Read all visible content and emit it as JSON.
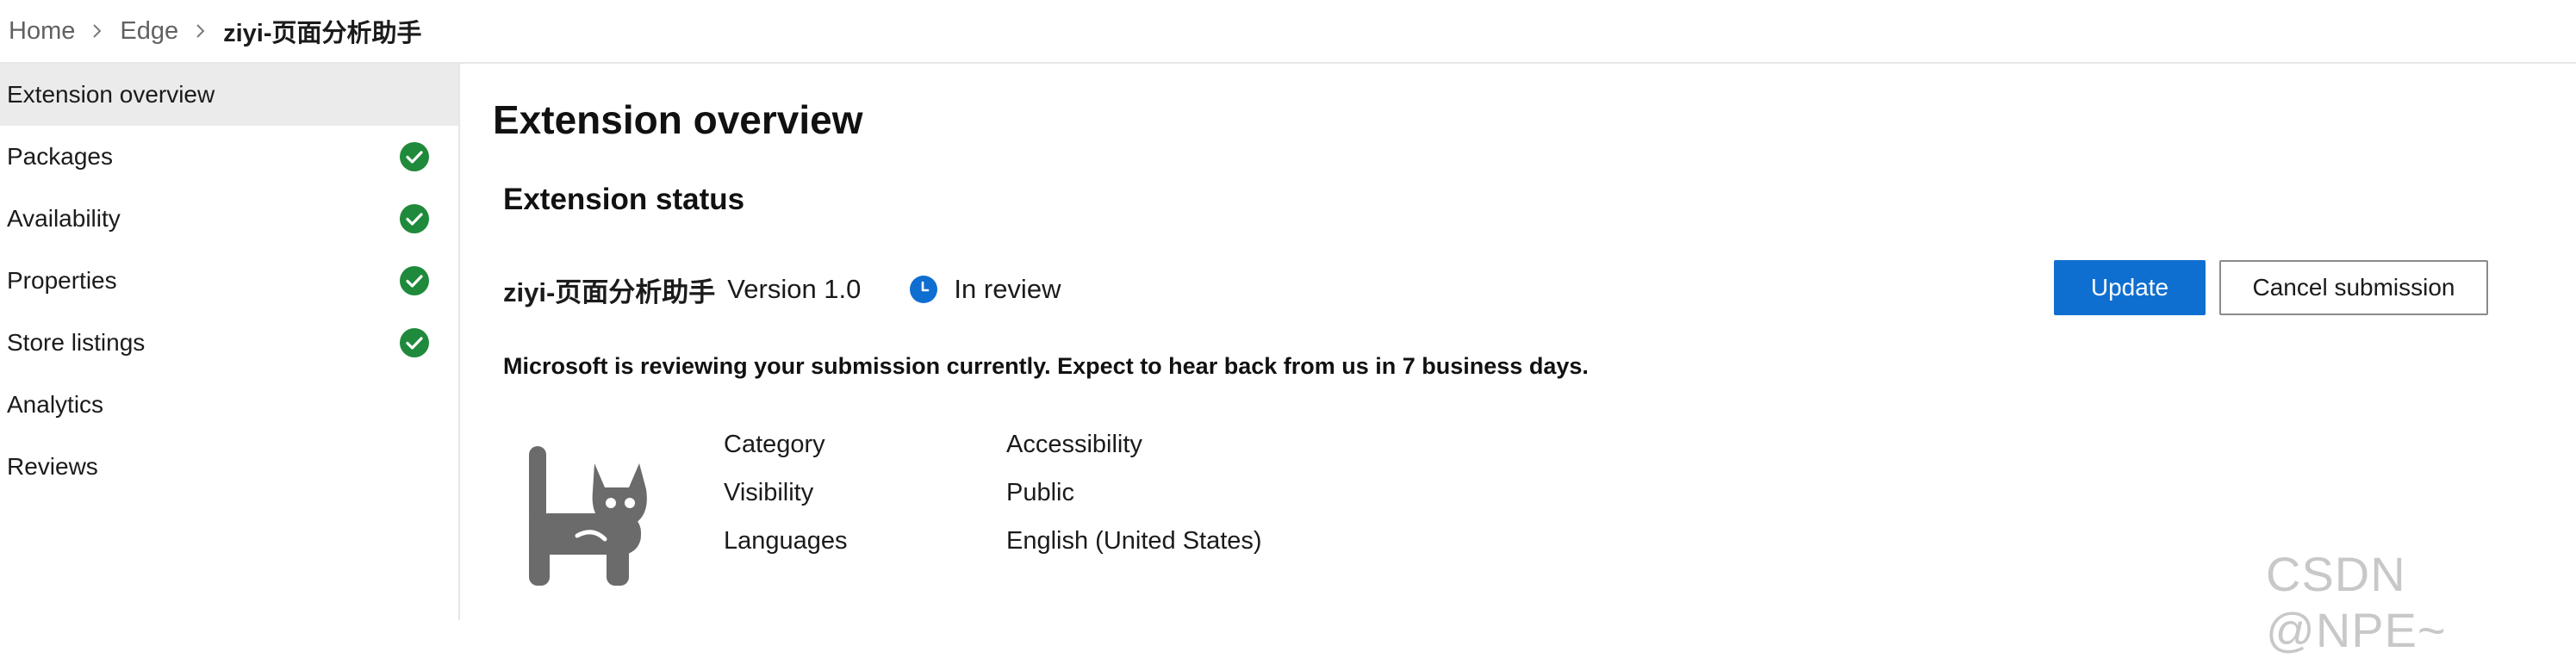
{
  "breadcrumb": {
    "items": [
      "Home",
      "Edge",
      "ziyi-页面分析助手"
    ]
  },
  "sidebar": {
    "items": [
      {
        "label": "Extension overview",
        "active": true,
        "complete": false
      },
      {
        "label": "Packages",
        "active": false,
        "complete": true
      },
      {
        "label": "Availability",
        "active": false,
        "complete": true
      },
      {
        "label": "Properties",
        "active": false,
        "complete": true
      },
      {
        "label": "Store listings",
        "active": false,
        "complete": true
      },
      {
        "label": "Analytics",
        "active": false,
        "complete": false
      },
      {
        "label": "Reviews",
        "active": false,
        "complete": false
      }
    ],
    "check_color": "#1f8a3b"
  },
  "main": {
    "title": "Extension overview",
    "section_title": "Extension status",
    "extension": {
      "name": "ziyi-页面分析助手",
      "version": "Version 1.0",
      "status": "In review",
      "status_icon": "clock-icon",
      "status_color": "#0f6fd1"
    },
    "buttons": {
      "update": "Update",
      "cancel": "Cancel submission"
    },
    "notice": "Microsoft is reviewing your submission currently. Expect to hear back from us in 7 business days.",
    "logo_icon": "cat-icon",
    "details": [
      {
        "label": "Category",
        "value": "Accessibility"
      },
      {
        "label": "Visibility",
        "value": "Public"
      },
      {
        "label": "Languages",
        "value": "English (United States)"
      }
    ]
  },
  "watermark": "CSDN @NPE~",
  "accent_color": "#0f6fd1"
}
